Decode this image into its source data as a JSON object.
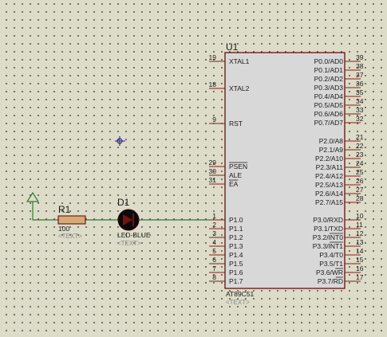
{
  "chip": {
    "ref": "U1",
    "part": "AT89C51",
    "placeholder": "<TEXT>",
    "left_pins": [
      {
        "num": "19",
        "name": "XTAL1"
      },
      {
        "num": "18",
        "name": "XTAL2"
      },
      {
        "num": "9",
        "name": "RST"
      },
      {
        "num": "29",
        "name": "PSEN"
      },
      {
        "num": "30",
        "name": "ALE"
      },
      {
        "num": "31",
        "name": "EA"
      },
      {
        "num": "1",
        "name": "P1.0"
      },
      {
        "num": "2",
        "name": "P1.1"
      },
      {
        "num": "3",
        "name": "P1.2"
      },
      {
        "num": "4",
        "name": "P1.3"
      },
      {
        "num": "5",
        "name": "P1.4"
      },
      {
        "num": "6",
        "name": "P1.5"
      },
      {
        "num": "7",
        "name": "P1.6"
      },
      {
        "num": "8",
        "name": "P1.7"
      }
    ],
    "right_pins": [
      {
        "num": "39",
        "name": "P0.0/AD0"
      },
      {
        "num": "38",
        "name": "P0.1/AD1"
      },
      {
        "num": "37",
        "name": "P0.2/AD2"
      },
      {
        "num": "36",
        "name": "P0.3/AD3"
      },
      {
        "num": "35",
        "name": "P0.4/AD4"
      },
      {
        "num": "34",
        "name": "P0.5/AD5"
      },
      {
        "num": "33",
        "name": "P0.6/AD6"
      },
      {
        "num": "32",
        "name": "P0.7/AD7"
      },
      {
        "num": "21",
        "name": "P2.0/A8"
      },
      {
        "num": "22",
        "name": "P2.1/A9"
      },
      {
        "num": "23",
        "name": "P2.2/A10"
      },
      {
        "num": "24",
        "name": "P2.3/A11"
      },
      {
        "num": "25",
        "name": "P2.4/A12"
      },
      {
        "num": "26",
        "name": "P2.5/A13"
      },
      {
        "num": "27",
        "name": "P2.6/A14"
      },
      {
        "num": "28",
        "name": "P2.7/A15"
      },
      {
        "num": "10",
        "name": "P3.0/RXD"
      },
      {
        "num": "11",
        "name": "P3.1/TXD"
      },
      {
        "num": "12",
        "name": "P3.2/INT0"
      },
      {
        "num": "13",
        "name": "P3.3/INT1"
      },
      {
        "num": "14",
        "name": "P3.4/T0"
      },
      {
        "num": "15",
        "name": "P3.5/T1"
      },
      {
        "num": "16",
        "name": "P3.6/WR"
      },
      {
        "num": "17",
        "name": "P3.7/RD"
      }
    ]
  },
  "resistor": {
    "ref": "R1",
    "value": "100",
    "placeholder": "<TEXT>"
  },
  "led": {
    "ref": "D1",
    "value": "LED-BLUE",
    "placeholder": "<TEXT>"
  },
  "colors": {
    "background": "#dcdcc8",
    "wire": "#2e7d32",
    "pin": "#8b1a1a",
    "chip_body": "#d8d8d8",
    "chip_border": "#5a0000",
    "led_fill": "#0a0a0a"
  }
}
